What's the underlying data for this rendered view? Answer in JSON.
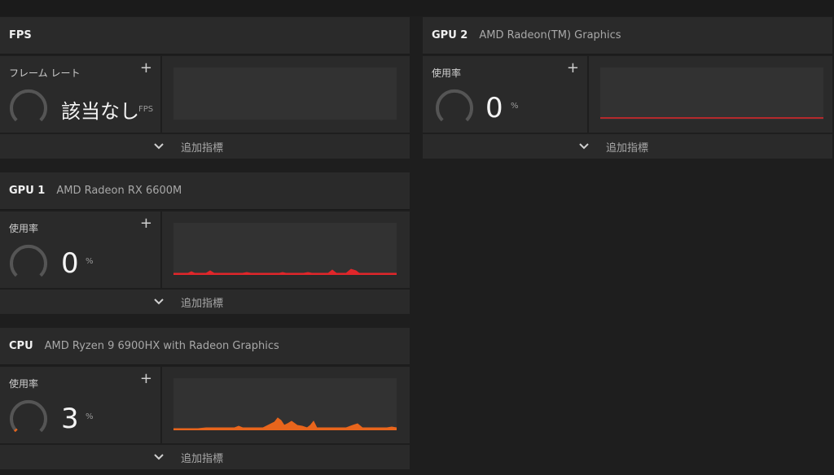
{
  "fps": {
    "title": "FPS",
    "metric_label": "フレーム レート",
    "value": "該当なし",
    "unit": "FPS",
    "more_label": "追加指標"
  },
  "gpu1": {
    "title": "GPU 1",
    "device": "AMD Radeon RX 6600M",
    "metric_label": "使用率",
    "value": "0",
    "unit": "%",
    "more_label": "追加指標",
    "graph_color": "#e0262a"
  },
  "cpu": {
    "title": "CPU",
    "device": "AMD Ryzen 9 6900HX with Radeon Graphics",
    "metric_label": "使用率",
    "value": "3",
    "unit": "%",
    "more_label": "追加指標",
    "graph_color": "#e8651c"
  },
  "gpu2": {
    "title": "GPU 2",
    "device": "AMD Radeon(TM) Graphics",
    "metric_label": "使用率",
    "value": "0",
    "unit": "%",
    "more_label": "追加指標",
    "graph_color": "#e0262a"
  },
  "colors": {
    "gauge_track": "#555555",
    "cpu_accent": "#e8651c",
    "gpu_accent": "#e0262a"
  }
}
